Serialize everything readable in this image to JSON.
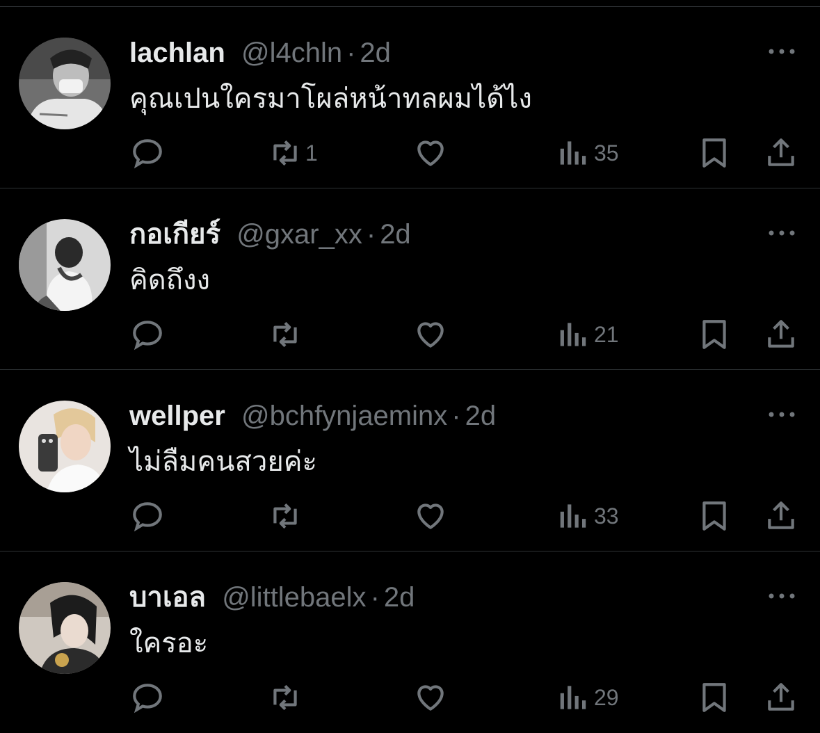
{
  "replies": [
    {
      "name": "lachlan",
      "handle": "@l4chln",
      "separator": "·",
      "time": "2d",
      "text": "คุณเปนใครมาโผล่หน้าทลผมได้ไง",
      "retweets": "1",
      "likes": "",
      "views": "35"
    },
    {
      "name": "กอเกียร์",
      "handle": "@gxar_xx",
      "separator": "·",
      "time": "2d",
      "text": "คิดถึงง",
      "retweets": "",
      "likes": "",
      "views": "21"
    },
    {
      "name": "wellper",
      "handle": "@bchfynjaeminx",
      "separator": "·",
      "time": "2d",
      "text": "ไม่ลืมคนสวยค่ะ",
      "retweets": "",
      "likes": "",
      "views": "33"
    },
    {
      "name": "บาเอล",
      "handle": "@littlebaelx",
      "separator": "·",
      "time": "2d",
      "text": "ใครอะ",
      "retweets": "",
      "likes": "",
      "views": "29"
    }
  ],
  "icons": {
    "reply": "reply-icon",
    "retweet": "retweet-icon",
    "like": "heart-icon",
    "views": "views-icon",
    "bookmark": "bookmark-icon",
    "share": "share-icon",
    "more": "more-icon"
  },
  "colors": {
    "background": "#000000",
    "text_primary": "#e7e9ea",
    "text_secondary": "#71767b",
    "divider": "#2f3336"
  }
}
